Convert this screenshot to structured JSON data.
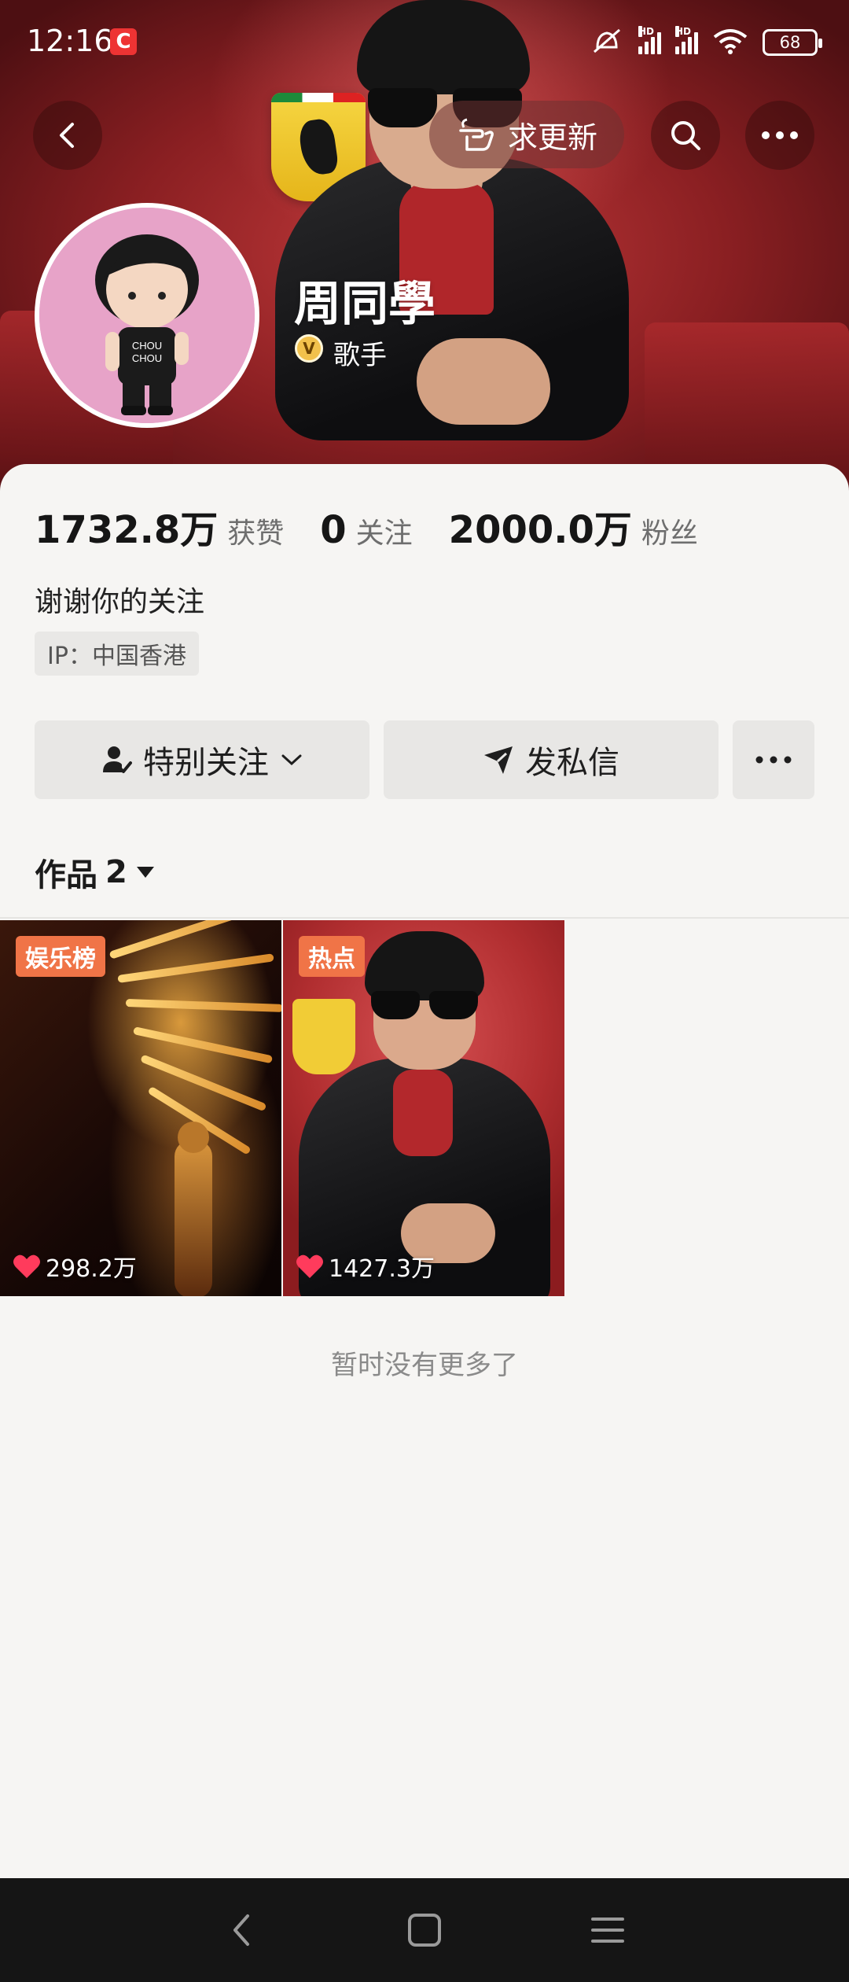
{
  "status_bar": {
    "time": "12:16",
    "notification_badge": "C",
    "network_1": "HD",
    "network_2": "HD",
    "battery": "68"
  },
  "header": {
    "request_update_label": "求更新",
    "icons": [
      "back-icon",
      "hand-point-icon",
      "search-icon",
      "more-icon"
    ]
  },
  "profile": {
    "name": "周同學",
    "role": "歌手",
    "verified_badge": "V",
    "bio": "谢谢你的关注",
    "ip": "IP：中国香港"
  },
  "stats": [
    {
      "value": "1732.8万",
      "label": "获赞"
    },
    {
      "value": "0",
      "label": "关注"
    },
    {
      "value": "2000.0万",
      "label": "粉丝"
    }
  ],
  "actions": {
    "special_follow": "特别关注",
    "message": "发私信"
  },
  "works": {
    "tab_label": "作品",
    "count": "2",
    "videos": [
      {
        "tag": "娱乐榜",
        "likes": "298.2万"
      },
      {
        "tag": "热点",
        "likes": "1427.3万"
      }
    ],
    "end_text": "暂时没有更多了"
  },
  "colors": {
    "accent_tag": "#f07447",
    "banner_red": "#b12e30",
    "like_heart": "#ff3b5c"
  }
}
